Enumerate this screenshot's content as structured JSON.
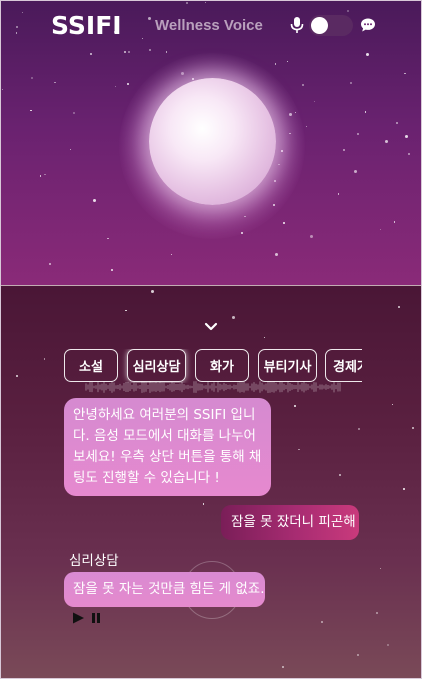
{
  "header": {
    "logo": "SSIFI",
    "app_name": "Wellness Voice",
    "mic_icon": "microphone-icon",
    "voice_toggle_on": false,
    "chat_icon": "chat-bubble-icon"
  },
  "colors": {
    "top_background": "#6a2270",
    "bottom_background": "#5a2040",
    "bot_bubble": "#e08ad0",
    "user_bubble": "#a82c72"
  },
  "tabs": [
    {
      "label": "소설",
      "active": false
    },
    {
      "label": "심리상담",
      "active": true
    },
    {
      "label": "화가",
      "active": false
    },
    {
      "label": "뷰티기사",
      "active": false
    },
    {
      "label": "경제가",
      "active": false
    }
  ],
  "chat": {
    "greeting_lines": [
      "안녕하세요 여러분의 SSIFI 입니",
      "다. 음성 모드에서 대화를 나누어",
      "보세요! 우측 상단 버튼을 통해 채",
      "팅도 진행할 수 있습니다 !"
    ],
    "user_message": "잠을 못 잤더니 피곤해",
    "sender_label": "심리상담",
    "bot_reply": "잠을 못 자는 것만큼 힘든 게 없죠.",
    "play_icon": "play-icon",
    "pause_icon": "pause-icon"
  }
}
